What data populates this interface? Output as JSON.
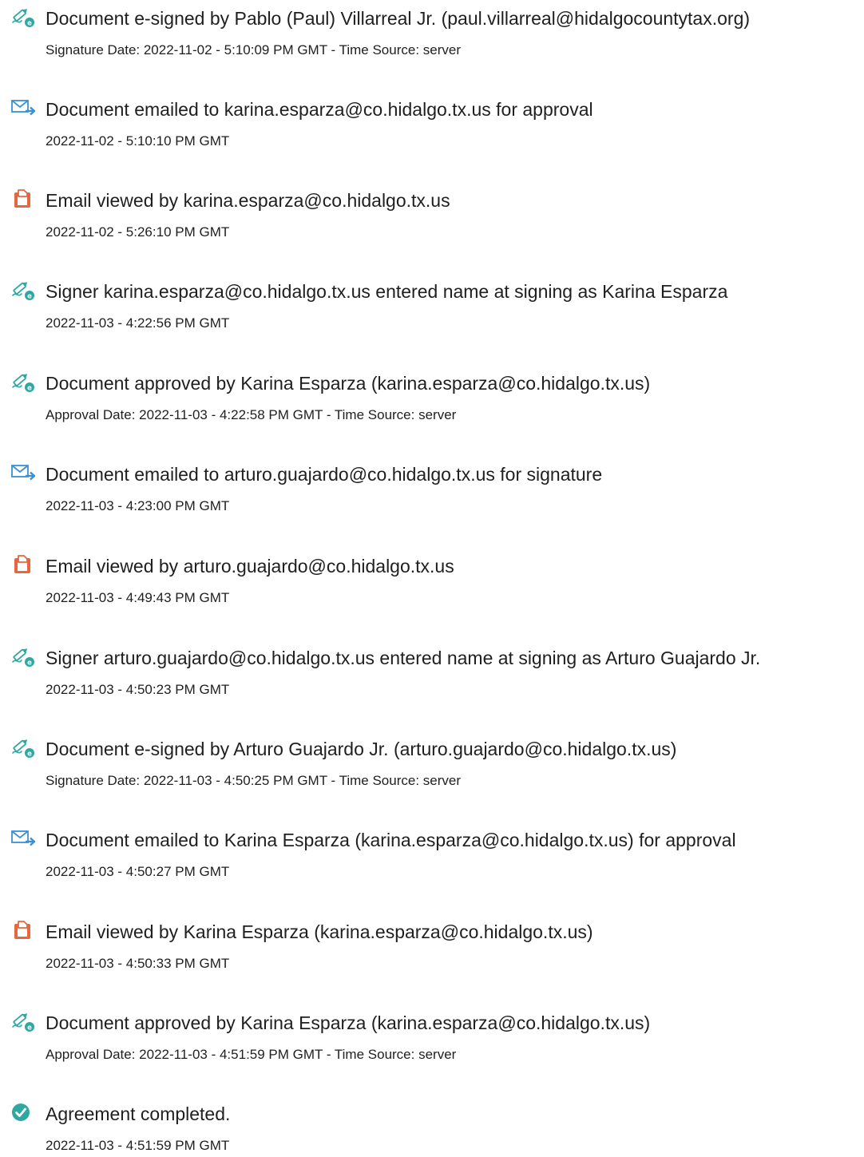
{
  "icons": {
    "esign": "pen-icon",
    "email": "envelope-arrow-icon",
    "viewed": "document-viewed-icon",
    "completed": "checkmark-circle-icon"
  },
  "colors": {
    "esign_accent": "#2ea8a0",
    "email_accent": "#3a8fd6",
    "viewed_accent": "#e8663d",
    "completed_accent": "#2ea8a0"
  },
  "events": [
    {
      "type": "esign",
      "title": "Document e-signed by Pablo (Paul) Villarreal Jr. (paul.villarreal@hidalgocountytax.org)",
      "date": "Signature Date: 2022-11-02 - 5:10:09 PM GMT - Time Source: server"
    },
    {
      "type": "email",
      "title": "Document emailed to karina.esparza@co.hidalgo.tx.us for approval",
      "date": "2022-11-02 - 5:10:10 PM GMT"
    },
    {
      "type": "viewed",
      "title": "Email viewed by karina.esparza@co.hidalgo.tx.us",
      "date": "2022-11-02 - 5:26:10 PM GMT"
    },
    {
      "type": "esign",
      "title": "Signer karina.esparza@co.hidalgo.tx.us entered name at signing as Karina Esparza",
      "date": "2022-11-03 - 4:22:56 PM GMT"
    },
    {
      "type": "esign",
      "title": "Document approved by Karina Esparza (karina.esparza@co.hidalgo.tx.us)",
      "date": "Approval Date: 2022-11-03 - 4:22:58 PM GMT - Time Source: server"
    },
    {
      "type": "email",
      "title": "Document emailed to arturo.guajardo@co.hidalgo.tx.us for signature",
      "date": "2022-11-03 - 4:23:00 PM GMT"
    },
    {
      "type": "viewed",
      "title": "Email viewed by arturo.guajardo@co.hidalgo.tx.us",
      "date": "2022-11-03 - 4:49:43 PM GMT"
    },
    {
      "type": "esign",
      "title": "Signer arturo.guajardo@co.hidalgo.tx.us entered name at signing as Arturo Guajardo Jr.",
      "date": "2022-11-03 - 4:50:23 PM GMT"
    },
    {
      "type": "esign",
      "title": "Document e-signed by Arturo Guajardo Jr. (arturo.guajardo@co.hidalgo.tx.us)",
      "date": "Signature Date: 2022-11-03 - 4:50:25 PM GMT - Time Source: server"
    },
    {
      "type": "email",
      "title": "Document emailed to Karina Esparza (karina.esparza@co.hidalgo.tx.us) for approval",
      "date": "2022-11-03 - 4:50:27 PM GMT"
    },
    {
      "type": "viewed",
      "title": "Email viewed by Karina Esparza (karina.esparza@co.hidalgo.tx.us)",
      "date": "2022-11-03 - 4:50:33 PM GMT"
    },
    {
      "type": "esign",
      "title": "Document approved by Karina Esparza (karina.esparza@co.hidalgo.tx.us)",
      "date": "Approval Date: 2022-11-03 - 4:51:59 PM GMT - Time Source: server"
    },
    {
      "type": "completed",
      "title": "Agreement completed.",
      "date": "2022-11-03 - 4:51:59 PM GMT"
    }
  ]
}
